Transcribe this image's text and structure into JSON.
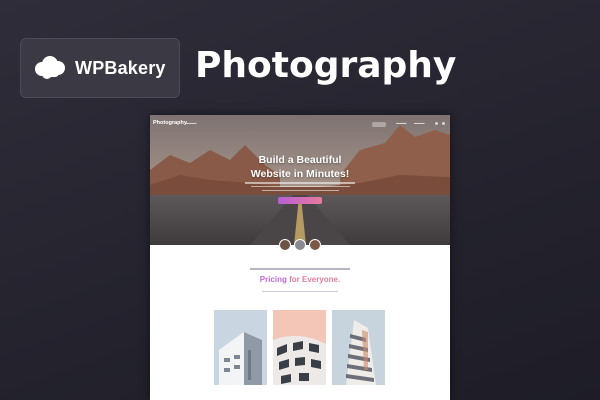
{
  "brand": {
    "name": "WPBakery",
    "logo_icon": "cloud-logo-icon"
  },
  "page_title": "Photography",
  "preview": {
    "nav": {
      "logo_text": "Photography"
    },
    "hero": {
      "title_line1": "Build a Beautiful",
      "title_line2": "Website in Minutes!",
      "cta_color": "#c46ad6"
    },
    "section": {
      "title_word": "Pricing",
      "title_rest": " for Everyone."
    }
  },
  "colors": {
    "background": "#282733",
    "accent_purple": "#c46ad6",
    "accent_pink": "#e07fa2"
  }
}
